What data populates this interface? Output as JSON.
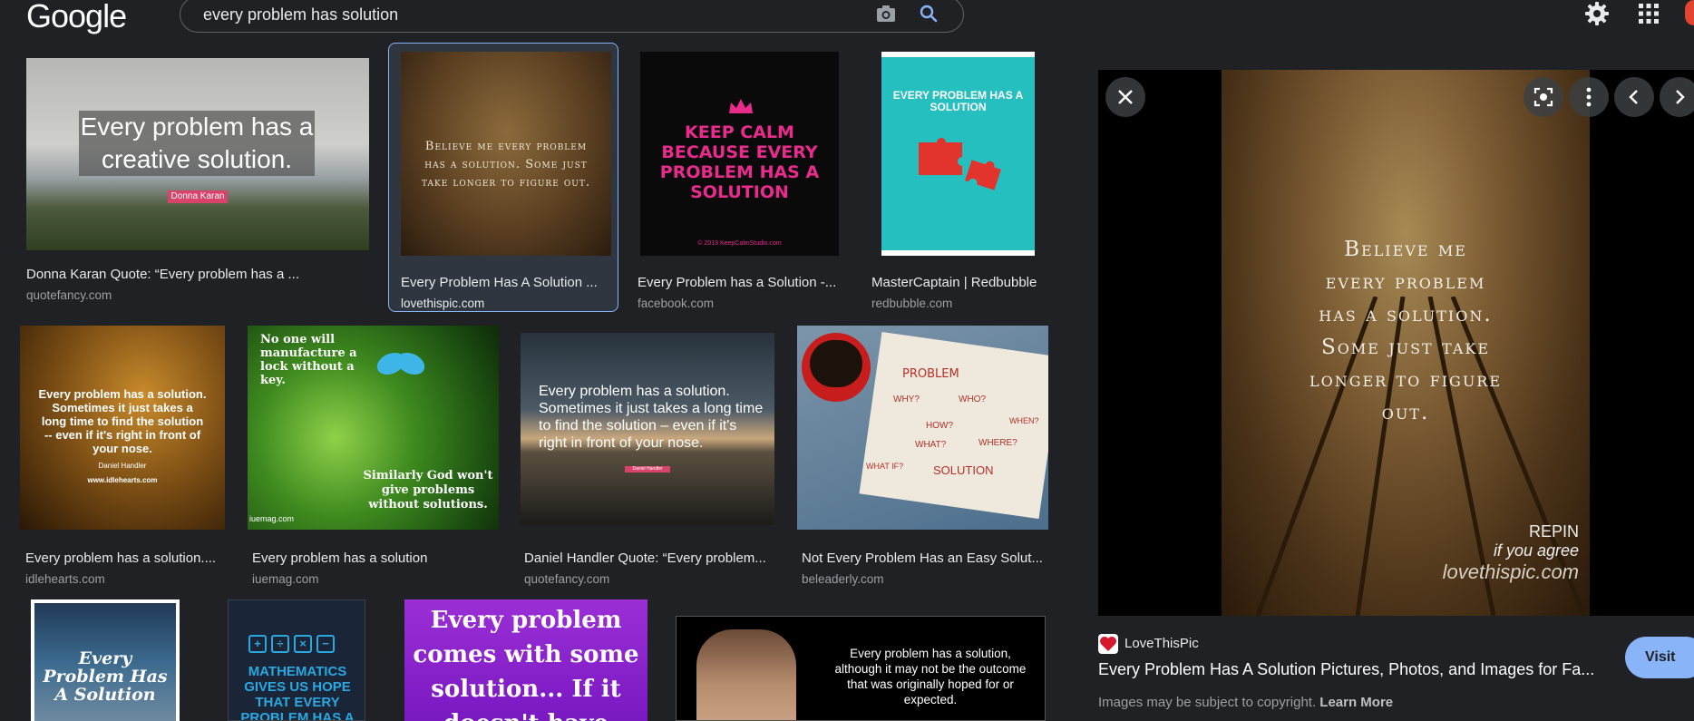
{
  "header": {
    "logo": "Google",
    "search_query": "every problem has solution",
    "icons": [
      "camera-icon",
      "search-icon",
      "gear-icon",
      "apps-icon"
    ]
  },
  "results": [
    {
      "title": "Donna Karan Quote: “Every problem has a ...",
      "source": "quotefancy.com",
      "image_text": "Every problem has a creative solution.",
      "image_caption": "Donna Karan"
    },
    {
      "title": "Every Problem Has A Solution ...",
      "source": "lovethispic.com",
      "image_text": "Believe me every problem has a solution. Some just take longer to figure out."
    },
    {
      "title": "Every Problem has a Solution -...",
      "source": "facebook.com",
      "image_text": "KEEP CALM BECAUSE EVERY PROBLEM HAS A SOLUTION",
      "image_caption": "© 2013 KeepCalmStudio.com"
    },
    {
      "title": "MasterCaptain | Redbubble",
      "source": "redbubble.com",
      "image_text": "EVERY PROBLEM HAS A SOLUTION"
    },
    {
      "title": "Every problem has a solution....",
      "source": "idlehearts.com",
      "image_text": "Every problem has a solution. Sometimes it just takes a long time to find the solution -- even if it's right in front of your nose.",
      "image_caption": "Daniel Handler",
      "image_site": "www.idlehearts.com"
    },
    {
      "title": "Every problem has a solution",
      "source": "iuemag.com",
      "image_text_top": "No one will manufacture a lock without a key.",
      "image_text_bottom": "Similarly God won't give problems without solutions.",
      "image_site": "iuemag.com"
    },
    {
      "title": "Daniel Handler Quote: “Every problem...",
      "source": "quotefancy.com",
      "image_text": "Every problem has a solution. Sometimes it just takes a long time to find the solution – even if it's right in front of your nose.",
      "image_caption": "Daniel Handler"
    },
    {
      "title": "Not Every Problem Has an Easy Solut...",
      "source": "beleaderly.com",
      "image_words": [
        "PROBLEM",
        "WHY?",
        "WHO?",
        "HOW?",
        "WHEN?",
        "WHAT?",
        "WHERE?",
        "WHAT IF?",
        "SOLUTION"
      ]
    },
    {
      "image_text": "Every Problem Has A Solution"
    },
    {
      "image_text": "MATHEMATICS GIVES US HOPE THAT EVERY PROBLEM HAS A SOLUTION",
      "image_symbols": [
        "+",
        "÷",
        "×",
        "−"
      ]
    },
    {
      "image_text": "Every problem comes with some solution... If it doesn't have"
    },
    {
      "image_text": "Every problem has a solution, although it may not be the outcome that was originally hoped for or expected."
    }
  ],
  "preview": {
    "quote_lines": [
      "Believe me",
      "every problem",
      "has a solution.",
      "Some just take",
      "longer to figure",
      "out."
    ],
    "repin": "REPIN",
    "agree": "if you agree",
    "watermark": "lovethispic.com",
    "source_name": "LoveThisPic",
    "title": "Every Problem Has A Solution Pictures, Photos, and Images for Fa...",
    "copyright": "Images may be subject to copyright.",
    "learn_more": "Learn More",
    "visit": "Visit",
    "buttons": [
      "close-icon",
      "lens-icon",
      "more-vert-icon",
      "chevron-left-icon",
      "chevron-right-icon"
    ]
  },
  "colors": {
    "background": "#202124",
    "accent": "#8ab4f8",
    "text": "#e8eaed",
    "muted": "#9aa0a6"
  }
}
